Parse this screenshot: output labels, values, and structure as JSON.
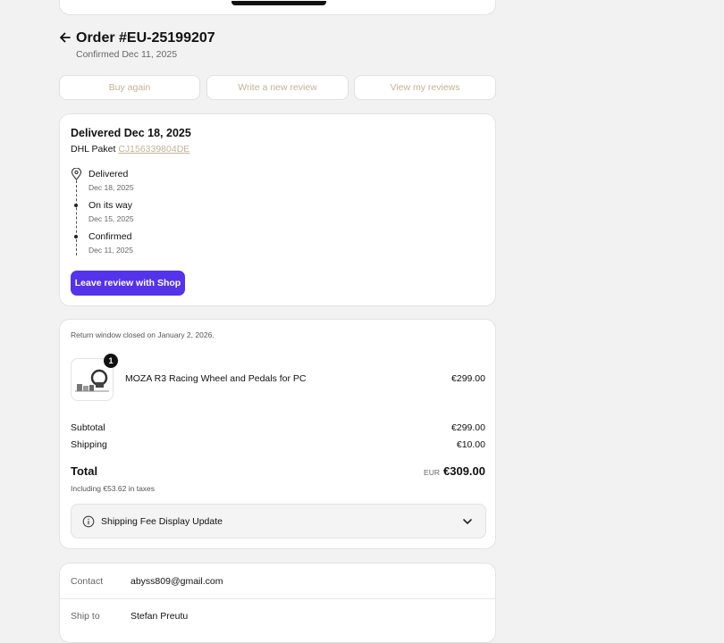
{
  "order": {
    "title": "Order #EU-25199207",
    "confirmed": "Confirmed Dec 11, 2025"
  },
  "actions": {
    "buy_again": "Buy again",
    "write_review": "Write a new review",
    "view_reviews": "View my reviews"
  },
  "delivery": {
    "title": "Delivered Dec 18, 2025",
    "carrier": "DHL Paket",
    "tracking": "CJ156339804DE",
    "timeline": [
      {
        "label": "Delivered",
        "date": "Dec 18, 2025",
        "icon": "location-pin-icon"
      },
      {
        "label": "On its way",
        "date": "Dec 15, 2025",
        "icon": "dot"
      },
      {
        "label": "Confirmed",
        "date": "Dec 11, 2025",
        "icon": "dot"
      }
    ],
    "review_button": "Leave review with Shop"
  },
  "summary": {
    "return_note": "Return window closed on January 2, 2026.",
    "item": {
      "quantity": "1",
      "name": "MOZA R3 Racing Wheel and Pedals for PC",
      "price": "€299.00"
    },
    "subtotal_label": "Subtotal",
    "subtotal": "€299.00",
    "shipping_label": "Shipping",
    "shipping": "€10.00",
    "total_label": "Total",
    "currency": "EUR",
    "total": "€309.00",
    "tax_note": "Including €53.62 in taxes",
    "fee_notice": "Shipping Fee Display Update"
  },
  "contact": {
    "contact_label": "Contact",
    "email": "abyss809@gmail.com",
    "ship_label": "Ship to",
    "name": "Stefan Preutu"
  },
  "colors": {
    "accent": "#5433eb",
    "muted_link": "#c2b394",
    "background": "#f2f2f2"
  }
}
